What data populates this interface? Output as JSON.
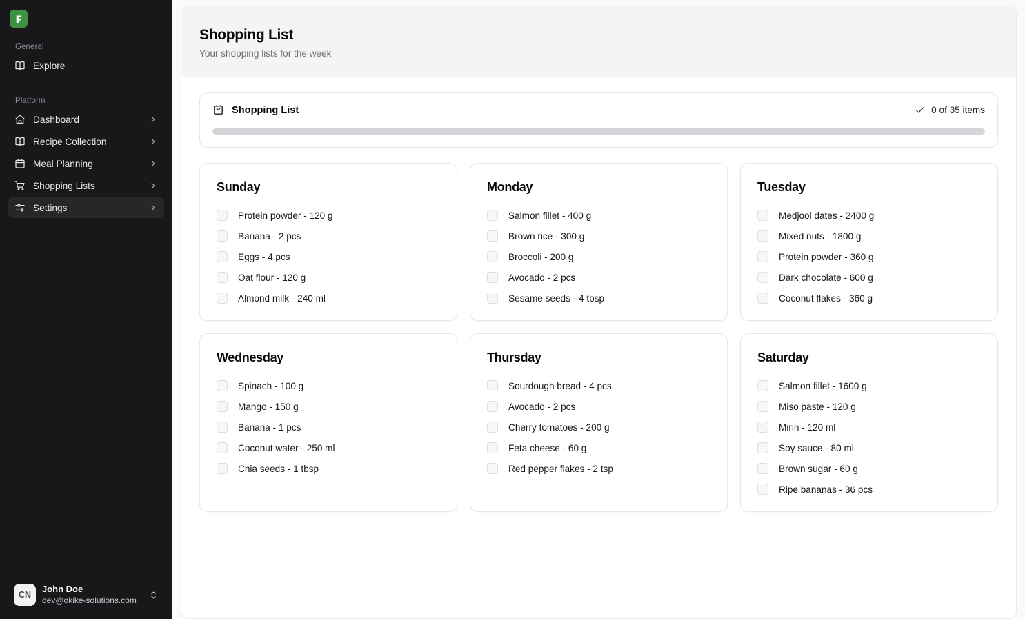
{
  "sidebar": {
    "logo": {
      "name": "app-logo",
      "glyph": "F",
      "color": "#3f9142"
    },
    "sections": [
      {
        "label": "General",
        "items": [
          {
            "label": "Explore",
            "icon": "book-open-icon",
            "chevron": false,
            "active": false
          }
        ]
      },
      {
        "label": "Platform",
        "items": [
          {
            "label": "Dashboard",
            "icon": "home-icon",
            "chevron": true,
            "active": false
          },
          {
            "label": "Recipe Collection",
            "icon": "book-open-icon",
            "chevron": true,
            "active": false
          },
          {
            "label": "Meal Planning",
            "icon": "calendar-icon",
            "chevron": true,
            "active": false
          },
          {
            "label": "Shopping Lists",
            "icon": "shopping-cart-icon",
            "chevron": true,
            "active": false
          },
          {
            "label": "Settings",
            "icon": "sliders-icon",
            "chevron": true,
            "active": true
          }
        ]
      }
    ],
    "user": {
      "initials": "CN",
      "name": "John Doe",
      "email": "dev@okike-solutions.com"
    }
  },
  "header": {
    "title": "Shopping List",
    "subtitle": "Your shopping lists for the week"
  },
  "summary": {
    "title": "Shopping List",
    "count_text": "0 of 35 items",
    "progress_percent": 0
  },
  "days": [
    {
      "title": "Sunday",
      "items": [
        "Protein powder - 120 g",
        "Banana - 2 pcs",
        "Eggs - 4 pcs",
        "Oat flour - 120 g",
        "Almond milk - 240 ml"
      ]
    },
    {
      "title": "Monday",
      "items": [
        "Salmon fillet - 400 g",
        "Brown rice - 300 g",
        "Broccoli - 200 g",
        "Avocado - 2 pcs",
        "Sesame seeds - 4 tbsp"
      ]
    },
    {
      "title": "Tuesday",
      "items": [
        "Medjool dates - 2400 g",
        "Mixed nuts - 1800 g",
        "Protein powder - 360 g",
        "Dark chocolate - 600 g",
        "Coconut flakes - 360 g"
      ]
    },
    {
      "title": "Wednesday",
      "items": [
        "Spinach - 100 g",
        "Mango - 150 g",
        "Banana - 1 pcs",
        "Coconut water - 250 ml",
        "Chia seeds - 1 tbsp"
      ]
    },
    {
      "title": "Thursday",
      "items": [
        "Sourdough bread - 4 pcs",
        "Avocado - 2 pcs",
        "Cherry tomatoes - 200 g",
        "Feta cheese - 60 g",
        "Red pepper flakes - 2 tsp"
      ]
    },
    {
      "title": "Saturday",
      "items": [
        "Salmon fillet - 1600 g",
        "Miso paste - 120 g",
        "Mirin - 120 ml",
        "Soy sauce - 80 ml",
        "Brown sugar - 60 g",
        "Ripe bananas - 36 pcs"
      ]
    }
  ]
}
